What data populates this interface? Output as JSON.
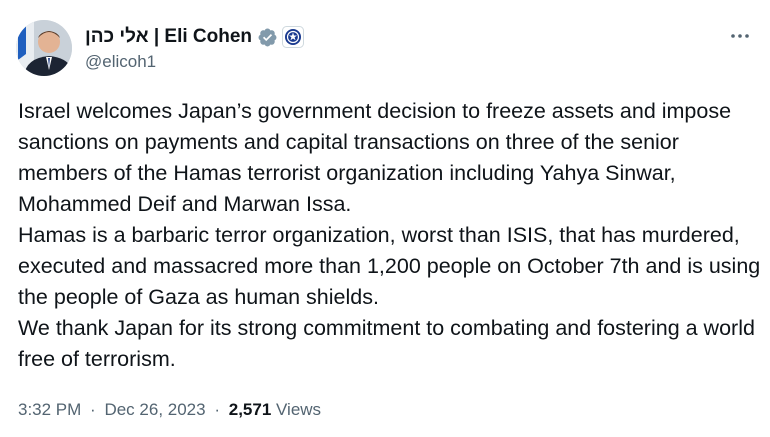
{
  "author": {
    "display_name": "אלי כהן | Eli Cohen",
    "handle": "@elicoh1",
    "verified_icon": "verified-badge-icon",
    "affiliate_icon": "government-affiliation-icon"
  },
  "menu": {
    "more_label": "···"
  },
  "tweet": {
    "paragraphs": [
      "Israel welcomes Japan’s government decision to freeze assets and impose sanctions on payments and capital transactions on three of the senior members of the Hamas terrorist organization including Yahya Sinwar, Mohammed Deif and Marwan Issa.",
      "Hamas is a barbaric terror organization, worst than ISIS, that has murdered, executed and massacred more than 1,200 people on October 7th and is using the people of Gaza as human shields.",
      "We thank Japan for its strong commitment to combating and fostering a world free of terrorism."
    ]
  },
  "meta": {
    "time": "3:32 PM",
    "separator": "·",
    "date": "Dec 26, 2023",
    "views_count": "2,571",
    "views_label": "Views"
  },
  "colors": {
    "text": "#0f1419",
    "secondary": "#536471",
    "badge_gray": "#829aab"
  }
}
